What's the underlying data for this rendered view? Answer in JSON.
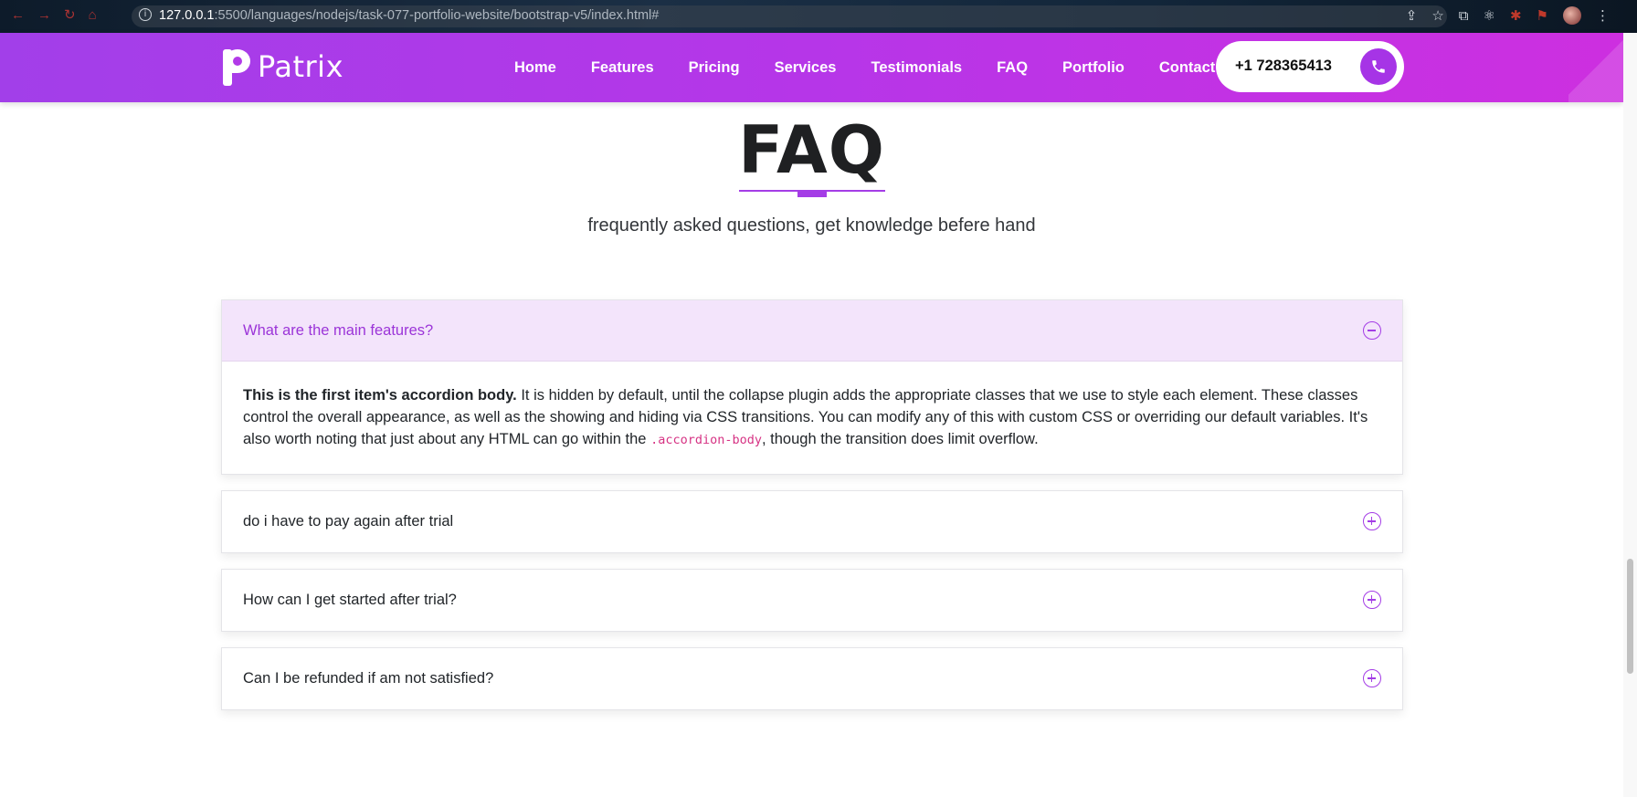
{
  "browser": {
    "url_host": "127.0.0.1",
    "url_rest": ":5500/languages/nodejs/task-077-portfolio-website/bootstrap-v5/index.html#"
  },
  "header": {
    "logo_text": "Patrix",
    "nav": [
      "Home",
      "Features",
      "Pricing",
      "Services",
      "Testimonials",
      "FAQ",
      "Portfolio",
      "Contact"
    ],
    "phone": "+1 728365413"
  },
  "faq": {
    "title": "FAQ",
    "subtitle": "frequently asked questions, get knowledge befere hand",
    "items": [
      {
        "question": "What are the main features?",
        "expanded": true,
        "body_strong": "This is the first item's accordion body.",
        "body_text": " It is hidden by default, until the collapse plugin adds the appropriate classes that we use to style each element. These classes control the overall appearance, as well as the showing and hiding via CSS transitions. You can modify any of this with custom CSS or overriding our default variables. It's also worth noting that just about any HTML can go within the ",
        "body_code": ".accordion-body",
        "body_tail": ", though the transition does limit overflow."
      },
      {
        "question": "do i have to pay again after trial",
        "expanded": false
      },
      {
        "question": "How can I get started after trial?",
        "expanded": false
      },
      {
        "question": "Can I be refunded if am not satisfied?",
        "expanded": false
      }
    ]
  },
  "colors": {
    "header_gradient_start": "#a23fe9",
    "header_gradient_end": "#cd2fe0",
    "accent": "#a43de6",
    "open_header_bg": "#f3e4fb"
  },
  "icons": {
    "phone": "phone-icon",
    "collapse": "minus-circle-icon",
    "expand": "plus-circle-icon"
  }
}
